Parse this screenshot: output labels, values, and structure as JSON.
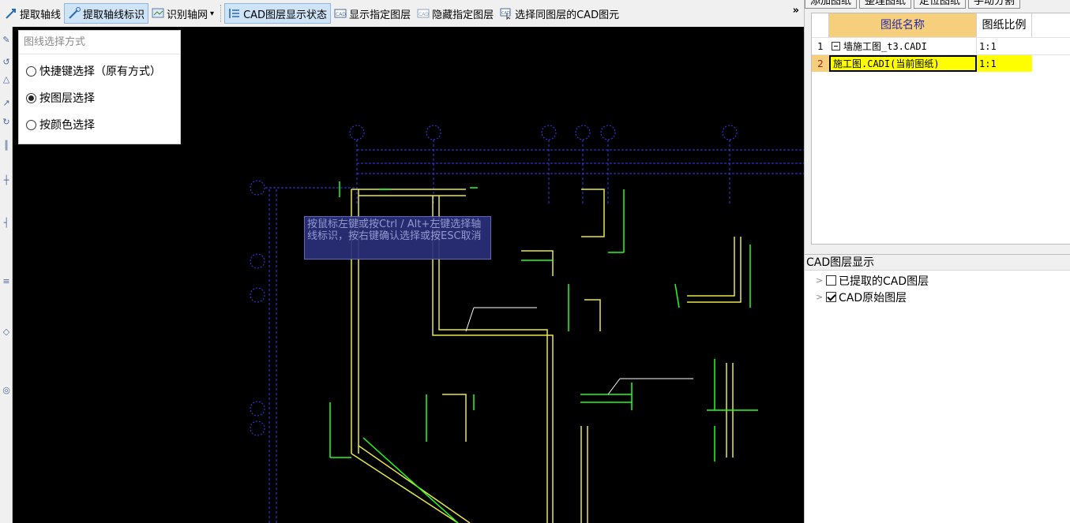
{
  "toolbar": {
    "items": [
      {
        "label": "提取轴线",
        "icon": "extract-axis-icon"
      },
      {
        "label": "提取轴线标识",
        "icon": "extract-axis-label-icon",
        "active": true
      },
      {
        "label": "识别轴网",
        "icon": "identify-grid-icon",
        "dropdown": "▾"
      },
      {
        "label": "CAD图层显示状态",
        "icon": "layer-display-icon",
        "active": true
      },
      {
        "label": "显示指定图层",
        "icon": "cad-show-icon"
      },
      {
        "label": "隐藏指定图层",
        "icon": "cad-hide-icon"
      },
      {
        "label": "选择同图层的CAD图元",
        "icon": "cad-select-icon"
      }
    ],
    "more": "»"
  },
  "popup": {
    "title": "图线选择方式",
    "options": [
      {
        "label": "快捷键选择（原有方式）",
        "checked": false
      },
      {
        "label": "按图层选择",
        "checked": true
      },
      {
        "label": "按颜色选择",
        "checked": false
      }
    ]
  },
  "tooltip": {
    "text": "按鼠标左键或按Ctrl / Alt+左键选择轴线标识，按右键确认选择或按ESC取消"
  },
  "right_panel": {
    "tabs": [
      "添加图纸",
      "整理图纸",
      "定位图纸",
      "手动分割"
    ],
    "grid": {
      "col_name": "图纸名称",
      "col_scale": "图纸比例",
      "rows": [
        {
          "num": "1",
          "name": "墙施工图_t3.CADI",
          "scale": "1:1",
          "selected": false
        },
        {
          "num": "2",
          "name": "施工图.CADI(当前图纸)",
          "scale": "1:1",
          "selected": true
        }
      ]
    },
    "layers": {
      "title": "CAD图层显示",
      "items": [
        {
          "label": "已提取的CAD图层",
          "checked": false
        },
        {
          "label": "CAD原始图层",
          "checked": true
        }
      ]
    }
  },
  "colors": {
    "canvas": "#000000",
    "axis_blue": "#3a3aff",
    "wall_yellow": "#e8e84a",
    "dim_green": "#22ff22",
    "header_orange": "#f6cf7d",
    "selected_yellow": "#ffff00"
  }
}
